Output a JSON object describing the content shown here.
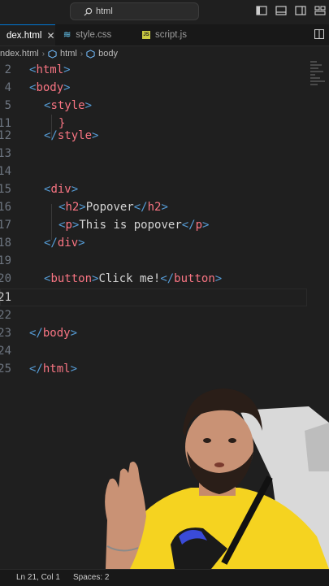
{
  "titlebar": {
    "search_text": "html",
    "icons": [
      "search-icon",
      "toggle-sidebar-icon",
      "toggle-panel-icon",
      "toggle-secondary-sidebar-icon",
      "customize-layout-icon"
    ]
  },
  "tabs": [
    {
      "label": "dex.html",
      "active": true,
      "icon": "html-icon"
    },
    {
      "label": "style.css",
      "active": false,
      "icon": "css-icon"
    },
    {
      "label": "script.js",
      "active": false,
      "icon": "js-icon"
    }
  ],
  "breadcrumb": {
    "file": "ndex.html",
    "items": [
      "html",
      "body"
    ]
  },
  "editor": {
    "lines": [
      {
        "num": "2",
        "code": "<html>"
      },
      {
        "num": "4",
        "code": "<body>"
      },
      {
        "num": "5",
        "code": "<style>"
      },
      {
        "num": "11",
        "code": "}"
      },
      {
        "num": "12",
        "code": "</style>"
      },
      {
        "num": "13",
        "code": ""
      },
      {
        "num": "14",
        "code": ""
      },
      {
        "num": "15",
        "code": "<div>"
      },
      {
        "num": "16",
        "code": "<h2>Popover</h2>"
      },
      {
        "num": "17",
        "code": "<p>This is popover</p>"
      },
      {
        "num": "18",
        "code": "</div>"
      },
      {
        "num": "19",
        "code": ""
      },
      {
        "num": "20",
        "code": "<button>Click me!</button>"
      },
      {
        "num": "21",
        "code": ""
      },
      {
        "num": "22",
        "code": ""
      },
      {
        "num": "23",
        "code": "</body>"
      },
      {
        "num": "24",
        "code": ""
      },
      {
        "num": "25",
        "code": "</html>"
      }
    ]
  },
  "statusbar": {
    "position": "Ln 21, Col 1",
    "spaces": "Spaces: 2"
  },
  "colors": {
    "background": "#1f1f1f",
    "tag_bracket": "#569cd6",
    "tag_name": "#f97583",
    "text": "#d4d4d4",
    "active_tab_border": "#0078d4",
    "shirt": "#f5d320"
  }
}
